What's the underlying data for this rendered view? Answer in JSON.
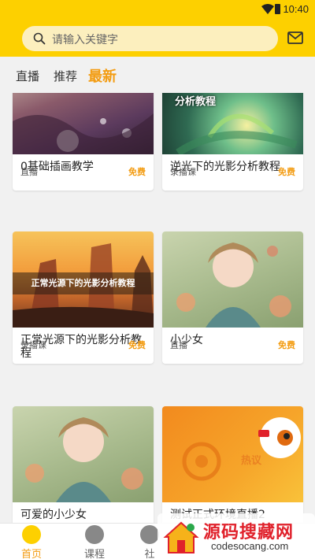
{
  "statusbar": {
    "time": "10:40"
  },
  "header": {
    "search_placeholder": "请输入关键字",
    "mail_icon": "mail-icon"
  },
  "tabs": [
    {
      "label": "直播",
      "active": false
    },
    {
      "label": "推荐",
      "active": false
    },
    {
      "label": "最新",
      "active": true
    }
  ],
  "colors": {
    "brand": "#fdd000",
    "accent": "#f39c12"
  },
  "cards": [
    {
      "title": "0基础插画教学",
      "type": "直播",
      "price": "免费"
    },
    {
      "title": "逆光下的光影分析教程",
      "type": "录播课",
      "price": "免费",
      "thumb_text": "分析教程"
    },
    {
      "title": "正常光源下的光影分析教程",
      "type": "录播课",
      "price": "免费",
      "thumb_text": "正常光源下的光影分析教程"
    },
    {
      "title": "小少女",
      "type": "直播",
      "price": "免费"
    },
    {
      "title": "可爱的小少女",
      "type": "",
      "price": ""
    },
    {
      "title": "测试正式环境直播2",
      "type": "",
      "price": "",
      "thumb_text": "热议"
    }
  ],
  "bottomnav": [
    {
      "label": "首页",
      "active": true
    },
    {
      "label": "课程",
      "active": false
    },
    {
      "label": "社",
      "active": false
    }
  ],
  "watermark": {
    "title": "源码搜藏网",
    "subtitle": "codesocang.com"
  }
}
